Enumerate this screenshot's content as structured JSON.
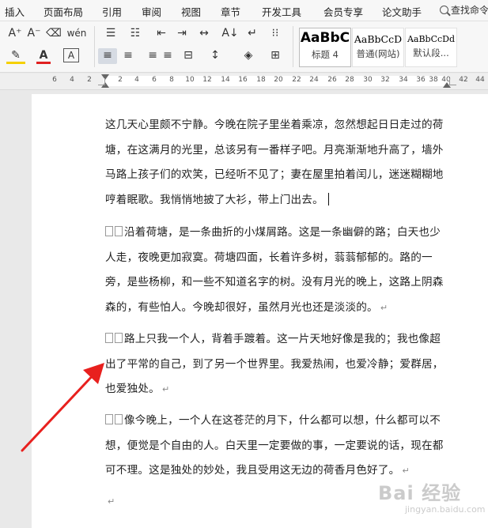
{
  "menubar": {
    "items": [
      "插入",
      "页面布局",
      "引用",
      "审阅",
      "视图",
      "章节",
      "开发工具",
      "会员专享",
      "论文助手"
    ],
    "search_label": "查找命令"
  },
  "ribbon": {
    "row1": {
      "grow_font": "A⁺",
      "shrink_font": "A⁻",
      "clear_format": "⌫",
      "phonetic": "wén",
      "bullets": "☰",
      "numbering": "☷",
      "outdent": "⇤",
      "indent": "⇥",
      "text_direction": "↔",
      "sort": "A↓",
      "line_break": "↵",
      "show_marks": "⁝⁝"
    },
    "row2": {
      "highlight": "✎",
      "font_color": "A",
      "char_border": "A",
      "align_left": "≡",
      "align_center": "≡",
      "align_right": "≡",
      "justify": "≡",
      "distributed": "⊟",
      "line_spacing": "↕",
      "shading": "◈",
      "borders": "⊞"
    },
    "styles": [
      {
        "sample": "AaBbC",
        "name": "标题 4"
      },
      {
        "sample": "AaBbCcD",
        "name": "普通(网站)"
      },
      {
        "sample": "AaBbCcDd",
        "name": "默认段..."
      }
    ]
  },
  "ruler": {
    "labels": [
      "6",
      "4",
      "2",
      "2",
      "4",
      "6",
      "8",
      "10",
      "12",
      "14",
      "16",
      "18",
      "20",
      "22",
      "24",
      "26",
      "28",
      "30",
      "32",
      "34",
      "36",
      "38",
      "40",
      "42",
      "44"
    ]
  },
  "document": {
    "p1": "这几天心里颇不宁静。今晚在院子里坐着乘凉，忽然想起日日走过的荷塘，在这满月的光里，总该另有一番样子吧。月亮渐渐地升高了，墙外马路上孩子们的欢笑，已经听不见了；妻在屋里拍着闰儿，迷迷糊糊地哼着眠歌。我悄悄地披了大衫，带上门出去。",
    "p2": "沿着荷塘，是一条曲折的小煤屑路。这是一条幽僻的路；白天也少人走，夜晚更加寂寞。荷塘四面，长着许多树，蓊蓊郁郁的。路的一旁，是些杨柳，和一些不知道名字的树。没有月光的晚上，这路上阴森森的，有些怕人。今晚却很好，虽然月光也还是淡淡的。",
    "p3": "路上只我一个人，背着手踱着。这一片天地好像是我的；我也像超出了平常的自己，到了另一个世界里。我爱热闹，也爱冷静；爱群居，也爱独处。",
    "p4": "像今晚上，一个人在这苍茫的月下，什么都可以想，什么都可以不想，便觉是个自由的人。白天里一定要做的事，一定要说的话，现在都可不理。这是独处的妙处，我且受用这无边的荷香月色好了。",
    "para_mark": "↵"
  },
  "watermark": {
    "main": "Bai 经验",
    "sub": "jingyan.baidu.com"
  },
  "colors": {
    "arrow": "#e8201e",
    "font_color_underline": "#e02020",
    "highlight_underline": "#f5d000"
  }
}
